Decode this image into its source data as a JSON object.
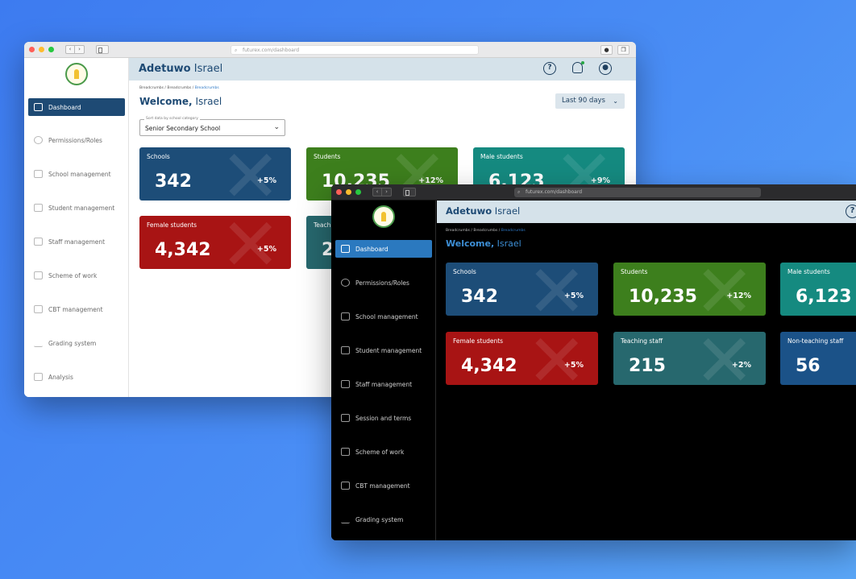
{
  "light_window": {
    "url": "futurex.com/dashboard",
    "user_first": "Adetuwo",
    "user_last": "Israel",
    "breadcrumb_prefix": "Breadcrumbs / Breadcrumbs / ",
    "breadcrumb_current": "Breadcrumbs",
    "welcome_bold": "Welcome,",
    "welcome_name": "Israel",
    "date_range": "Last 90 days",
    "filter_label": "Sort data by school category",
    "filter_value": "Senior Secondary School",
    "sidebar": [
      {
        "label": "Dashboard",
        "icon": "dashboard-icon",
        "active": true
      },
      {
        "label": "Permissions/Roles",
        "icon": "permissions-icon"
      },
      {
        "label": "School management",
        "icon": "school-icon"
      },
      {
        "label": "Student management",
        "icon": "graduation-cap-icon"
      },
      {
        "label": "Staff management",
        "icon": "staff-icon"
      },
      {
        "label": "Scheme of work",
        "icon": "scheme-icon"
      },
      {
        "label": "CBT management",
        "icon": "monitor-icon"
      },
      {
        "label": "Grading system",
        "icon": "chart-line-icon"
      },
      {
        "label": "Analysis",
        "icon": "analysis-icon"
      }
    ],
    "cards": [
      {
        "label": "Schools",
        "value": "342",
        "change": "+5%"
      },
      {
        "label": "Students",
        "value": "10,235",
        "change": "+12%"
      },
      {
        "label": "Male students",
        "value": "6,123",
        "change": "+9%"
      },
      {
        "label": "Female students",
        "value": "4,342",
        "change": "+5%"
      },
      {
        "label": "Teaching staff",
        "value": "2",
        "change": ""
      }
    ]
  },
  "dark_window": {
    "url": "futurex.com/dashboard",
    "user_first": "Adetuwo",
    "user_last": "Israel",
    "breadcrumb_prefix": "Breadcrumbs / Breadcrumbs / ",
    "breadcrumb_current": "Breadcrumbs",
    "welcome_bold": "Welcome,",
    "welcome_name": "Israel",
    "sidebar": [
      {
        "label": "Dashboard",
        "icon": "dashboard-icon",
        "active": true
      },
      {
        "label": "Permissions/Roles",
        "icon": "permissions-icon"
      },
      {
        "label": "School management",
        "icon": "school-icon"
      },
      {
        "label": "Student management",
        "icon": "graduation-cap-icon"
      },
      {
        "label": "Staff management",
        "icon": "staff-icon"
      },
      {
        "label": "Session and terms",
        "icon": "calendar-icon"
      },
      {
        "label": "Scheme of work",
        "icon": "scheme-icon"
      },
      {
        "label": "CBT management",
        "icon": "monitor-icon"
      },
      {
        "label": "Grading system",
        "icon": "chart-line-icon"
      }
    ],
    "cards": [
      {
        "label": "Schools",
        "value": "342",
        "change": "+5%"
      },
      {
        "label": "Students",
        "value": "10,235",
        "change": "+12%"
      },
      {
        "label": "Male students",
        "value": "6,123",
        "change": ""
      },
      {
        "label": "Female students",
        "value": "4,342",
        "change": "+5%"
      },
      {
        "label": "Teaching staff",
        "value": "215",
        "change": "+2%"
      },
      {
        "label": "Non-teaching staff",
        "value": "56",
        "change": ""
      }
    ]
  },
  "colors": {
    "primary_navy": "#1e4a74",
    "active_blue": "#2b79bf",
    "card_green": "#3d7f1d",
    "card_teal": "#158a80",
    "card_red": "#a81414"
  }
}
